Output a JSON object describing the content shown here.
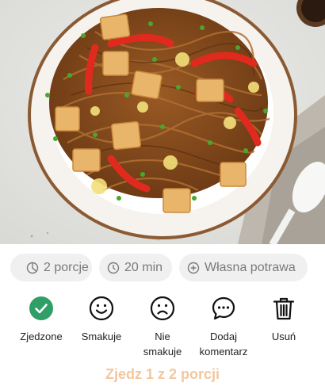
{
  "image": {
    "alt": "",
    "icon": "food-photo"
  },
  "meta_chips": {
    "portions": {
      "icon": "pie-icon",
      "label": "2 porcje"
    },
    "time": {
      "icon": "clock-icon",
      "label": "20 min"
    },
    "own_dish": {
      "icon": "plus-circle-icon",
      "label": "Własna potrawa"
    }
  },
  "actions": {
    "eaten": {
      "icon": "check-circle-icon",
      "label": "Zjedzone",
      "color": "#2f9e67"
    },
    "like": {
      "icon": "smile-icon",
      "label": "Smakuje"
    },
    "dislike": {
      "icon": "frown-icon",
      "label": "Nie smakuje"
    },
    "comment": {
      "icon": "comment-icon",
      "label": "Dodaj komentarz"
    },
    "delete": {
      "icon": "trash-icon",
      "label": "Usuń"
    }
  },
  "cta": {
    "label": "Zjedz 1 z 2 porcji",
    "color": "#f3c79d"
  }
}
